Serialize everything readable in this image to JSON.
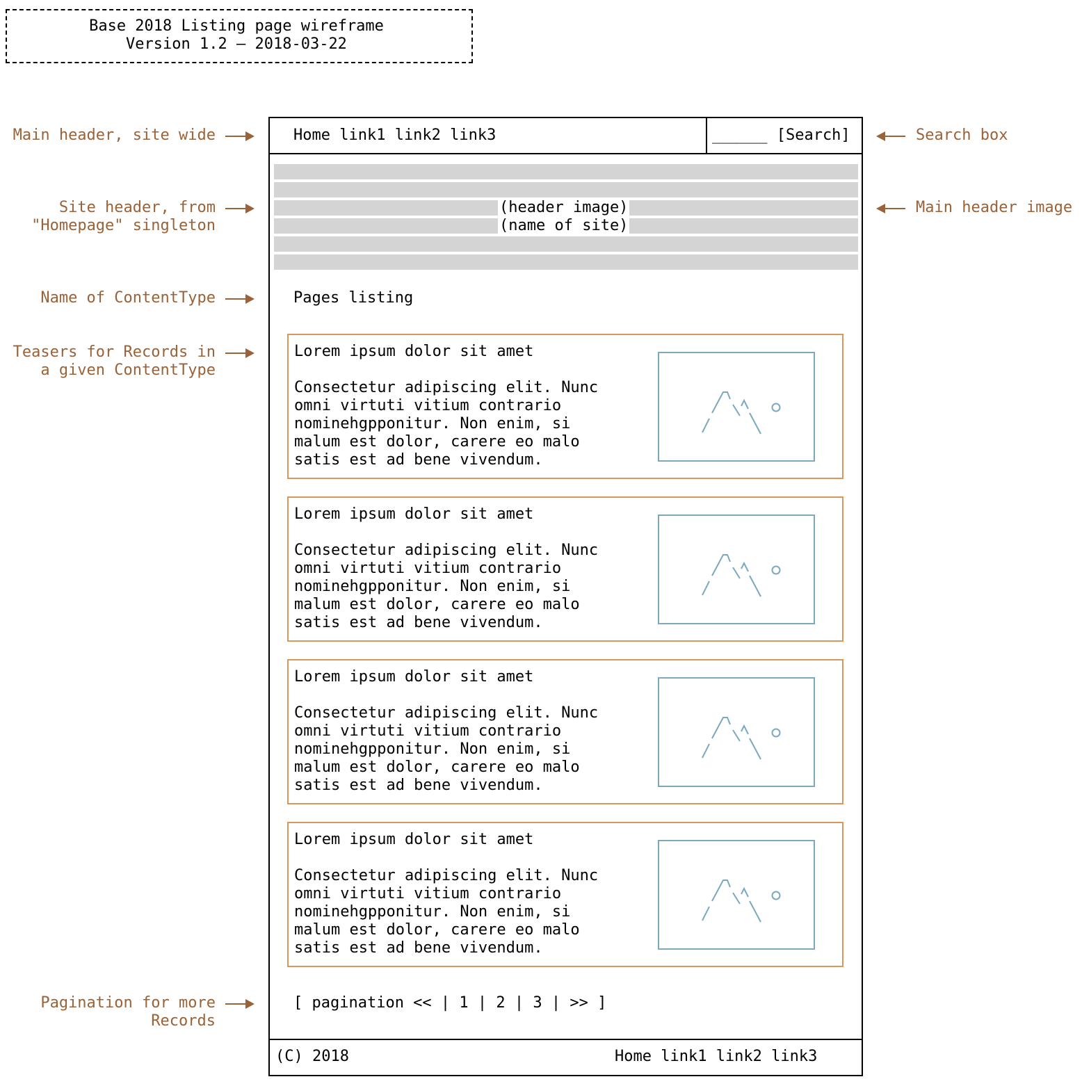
{
  "title_box": {
    "line1": "Base 2018 Listing page wireframe",
    "line2": "Version 1.2 – 2018-03-22"
  },
  "annotations": {
    "main_header": "Main header, site wide",
    "site_header": "Site header, from\n\"Homepage\" singleton",
    "content_type_name": "Name of ContentType",
    "teasers": "Teasers for Records in\na given ContentType",
    "pagination": "Pagination for more\nRecords",
    "search_box": "Search box",
    "main_header_image": "Main header image"
  },
  "main_header": {
    "links": "Home link1 link2 link3",
    "search": "______ [Search]"
  },
  "site_header": {
    "line1": "(header image)",
    "line2": "(name of site)"
  },
  "listing_title": "Pages listing",
  "teasers": [
    {
      "title": "Lorem ipsum dolor sit amet",
      "body": "Consectetur adipiscing elit. Nunc\nomni virtuti vitium contrario\nnominehgpponitur. Non enim, si\nmalum est dolor, carere eo malo\nsatis est ad bene vivendum."
    },
    {
      "title": "Lorem ipsum dolor sit amet",
      "body": "Consectetur adipiscing elit. Nunc\nomni virtuti vitium contrario\nnominehgpponitur. Non enim, si\nmalum est dolor, carere eo malo\nsatis est ad bene vivendum."
    },
    {
      "title": "Lorem ipsum dolor sit amet",
      "body": "Consectetur adipiscing elit. Nunc\nomni virtuti vitium contrario\nnominehgpponitur. Non enim, si\nmalum est dolor, carere eo malo\nsatis est ad bene vivendum."
    },
    {
      "title": "Lorem ipsum dolor sit amet",
      "body": "Consectetur adipiscing elit. Nunc\nomni virtuti vitium contrario\nnominehgpponitur. Non enim, si\nmalum est dolor, carere eo malo\nsatis est ad bene vivendum."
    }
  ],
  "pagination": "[ pagination << | 1 | 2 | 3 | >> ]",
  "footer": {
    "copyright": "(C) 2018",
    "links": "Home link1 link2 link3"
  },
  "colors": {
    "annotation": "#9a6238",
    "teaser_border": "#d9975c",
    "thumbnail": "#7aa9bf"
  }
}
